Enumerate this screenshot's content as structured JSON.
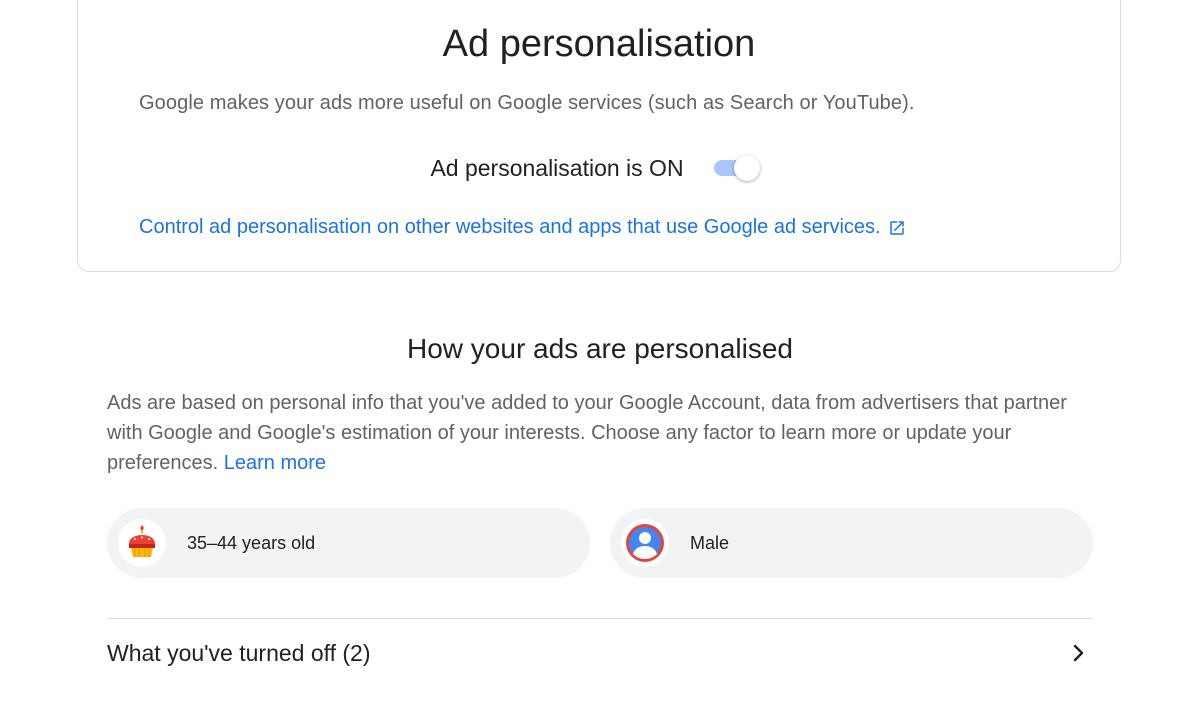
{
  "card": {
    "title": "Ad personalisation",
    "description": "Google makes your ads more useful on Google services (such as Search or YouTube).",
    "toggle_label": "Ad personalisation is ON",
    "toggle_state": "on",
    "link_text": "Control ad personalisation on other websites and apps that use Google ad services.",
    "link_icon": "external-link-icon"
  },
  "section": {
    "title": "How your ads are personalised",
    "description": "Ads are based on personal info that you've added to your Google Account, data from advertisers that partner with Google and Google's estimation of your interests. Choose any factor to learn more or update your preferences.",
    "learn_more": "Learn more"
  },
  "factors": [
    {
      "label": "35–44 years old",
      "icon": "birthday-cake-icon"
    },
    {
      "label": "Male",
      "icon": "person-avatar-icon"
    }
  ],
  "turned_off": {
    "label": "What you've turned off (2)",
    "icon": "chevron-right-icon"
  },
  "colors": {
    "link": "#1a73e8",
    "toggle_track": "#a8c7fa",
    "chip_bg": "#f1f3f4",
    "text_primary": "#202124",
    "text_secondary": "#5f6368",
    "border": "#dadce0"
  }
}
